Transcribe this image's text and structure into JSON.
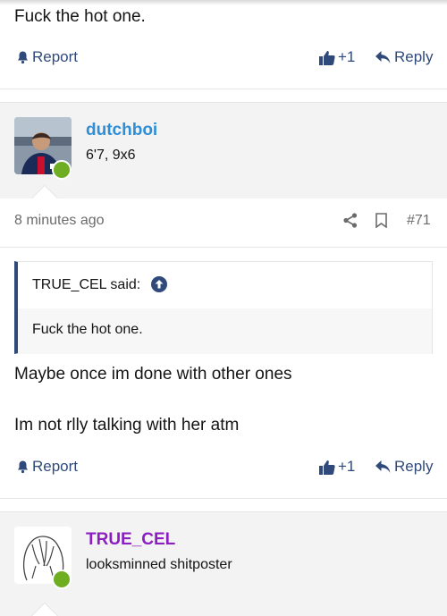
{
  "post_top": {
    "body_text": "Fuck the hot one.",
    "actions": {
      "report": "Report",
      "like_count": "+1",
      "reply": "Reply"
    }
  },
  "post_main": {
    "user": {
      "name": "dutchboi",
      "title": "6'7, 9x6",
      "name_color": "#2e8ed6"
    },
    "meta": {
      "time": "8 minutes ago",
      "post_number": "#71"
    },
    "quote": {
      "author_label": "TRUE_CEL said:",
      "text": "Fuck the hot one."
    },
    "body_lines": [
      "Maybe once im done with other ones",
      "Im not rlly talking with her atm"
    ],
    "actions": {
      "report": "Report",
      "like_count": "+1",
      "reply": "Reply"
    }
  },
  "post_next": {
    "user": {
      "name": "TRUE_CEL",
      "title": "looksminned shitposter",
      "name_color": "#8b1fc0"
    }
  },
  "colors": {
    "action_blue": "#2f4a7a",
    "online_green": "#6fad23",
    "quote_bar": "#2f4a7a"
  },
  "icons": [
    "bell-icon",
    "thumbs-up-icon",
    "reply-arrow-icon",
    "share-icon",
    "bookmark-icon",
    "arrow-up-circle-icon"
  ]
}
